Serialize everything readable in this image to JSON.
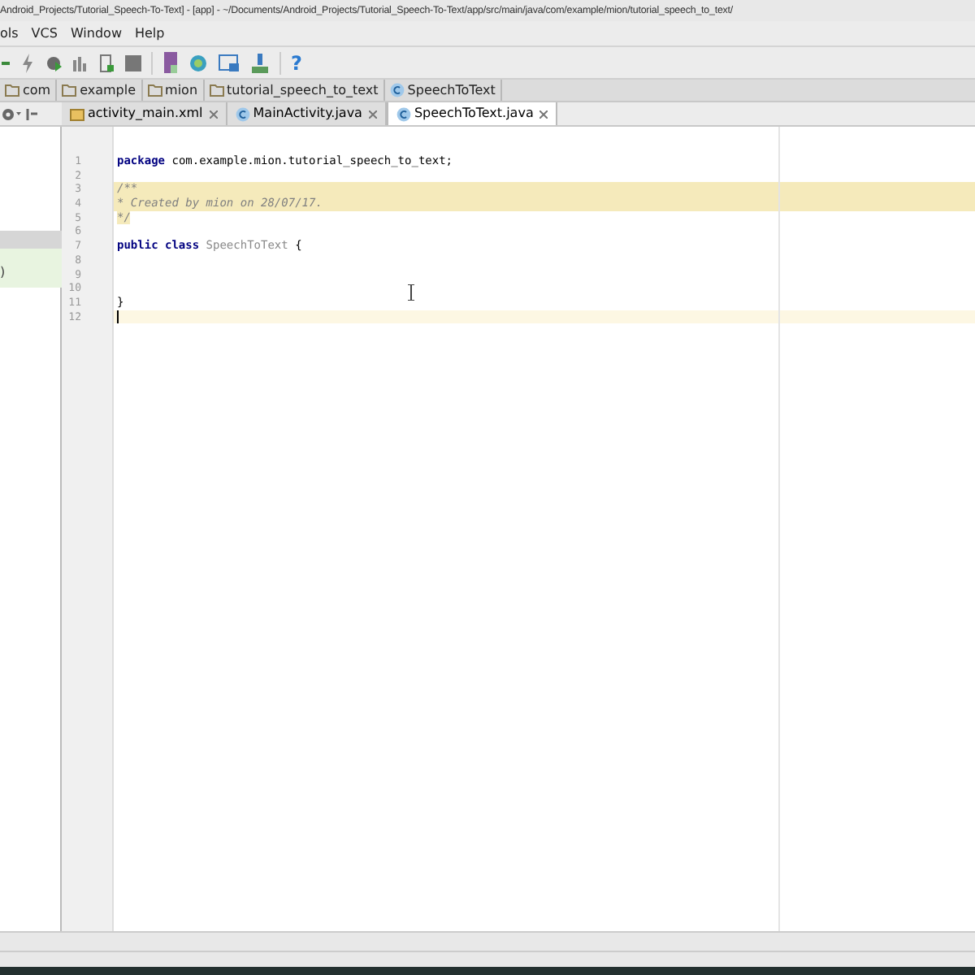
{
  "window": {
    "title": "Android_Projects/Tutorial_Speech-To-Text] - [app] - ~/Documents/Android_Projects/Tutorial_Speech-To-Text/app/src/main/java/com/example/mion/tutorial_speech_to_text/"
  },
  "menu": [
    "ols",
    "VCS",
    "Window",
    "Help"
  ],
  "toolbar": {
    "help": "?"
  },
  "breadcrumbs": [
    {
      "label": "com",
      "kind": "folder"
    },
    {
      "label": "example",
      "kind": "folder"
    },
    {
      "label": "mion",
      "kind": "folder"
    },
    {
      "label": "tutorial_speech_to_text",
      "kind": "folder"
    },
    {
      "label": "SpeechToText",
      "kind": "class"
    }
  ],
  "tabs": [
    {
      "label": "activity_main.xml",
      "kind": "xml",
      "selected": false
    },
    {
      "label": "MainActivity.java",
      "kind": "class",
      "selected": false
    },
    {
      "label": "SpeechToText.java",
      "kind": "class",
      "selected": true
    }
  ],
  "left_panel": {
    "text": ")"
  },
  "code": [
    {
      "number": "1",
      "kind": "plain",
      "tokens": [
        {
          "kind": "keyword",
          "text": "package"
        },
        {
          "kind": "plain",
          "text": " com.example.mion.tutorial_speech_to_text;"
        }
      ]
    },
    {
      "number": "2",
      "kind": "plain"
    },
    {
      "number": "3",
      "kind": "doc",
      "tokens": [
        {
          "kind": "comment",
          "text": "/**"
        }
      ]
    },
    {
      "number": "4",
      "kind": "doc",
      "tokens": [
        {
          "kind": "comment",
          "text": " * Created by mion on 28/07/17."
        }
      ]
    },
    {
      "number": "5",
      "kind": "docend",
      "tokens": [
        {
          "kind": "comment",
          "text": " */"
        }
      ]
    },
    {
      "number": "6",
      "kind": "plain"
    },
    {
      "number": "7",
      "kind": "plain",
      "tokens": [
        {
          "kind": "keyword",
          "text": "public class"
        },
        {
          "kind": "classname",
          "text": " SpeechToText"
        },
        {
          "kind": "plain",
          "text": " {"
        }
      ]
    },
    {
      "number": "8",
      "kind": "plain"
    },
    {
      "number": "9",
      "kind": "plain"
    },
    {
      "number": "10",
      "kind": "plain"
    },
    {
      "number": "11",
      "kind": "plain",
      "tokens": [
        {
          "kind": "plain",
          "text": "}"
        }
      ]
    },
    {
      "number": "12",
      "kind": "current"
    }
  ]
}
